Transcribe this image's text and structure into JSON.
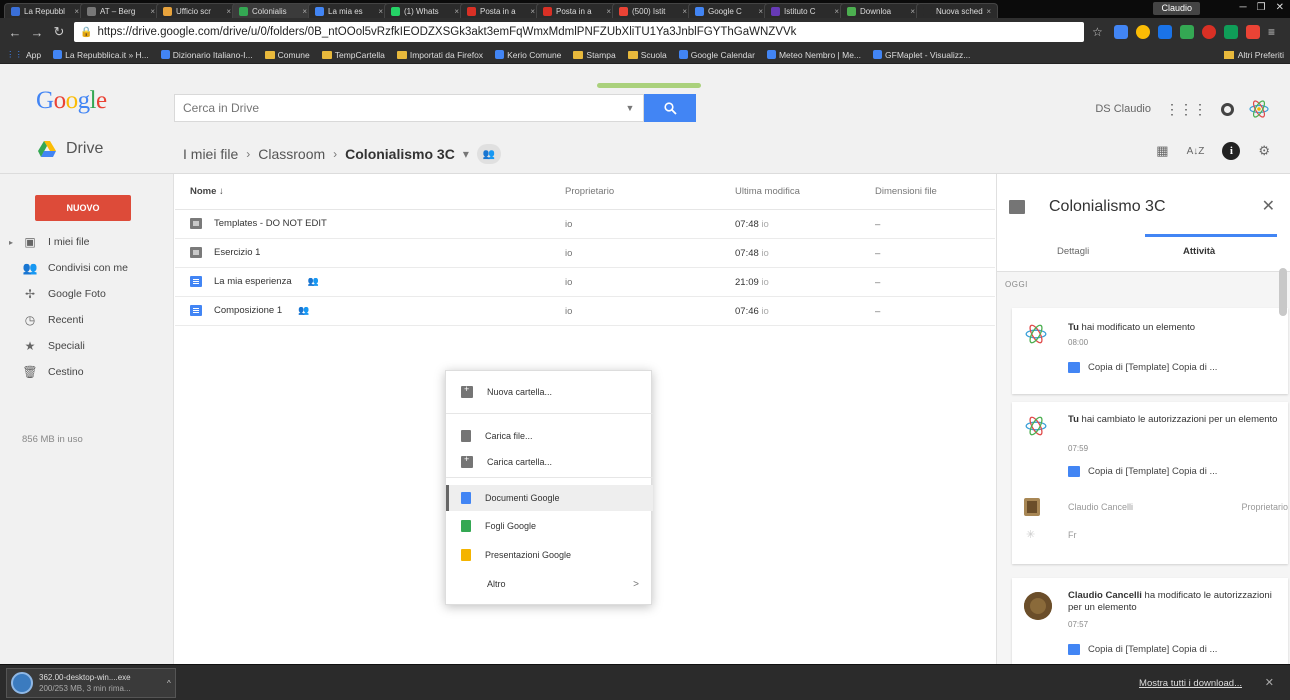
{
  "browser": {
    "tabs": [
      {
        "label": "La Repubbl",
        "color": "#3a6fd8"
      },
      {
        "label": "AT – Berg",
        "color": "#777777"
      },
      {
        "label": "Ufficio scr",
        "color": "#e8a33c"
      },
      {
        "label": "Colonialis",
        "color": "#34a853",
        "active": true
      },
      {
        "label": "La mia es",
        "color": "#4285f4"
      },
      {
        "label": "(1) Whats",
        "color": "#25d366"
      },
      {
        "label": "Posta in a",
        "color": "#d93025"
      },
      {
        "label": "Posta in a",
        "color": "#d93025"
      },
      {
        "label": "(500) Istit",
        "color": "#ea4335"
      },
      {
        "label": "Google C",
        "color": "#4285f4"
      },
      {
        "label": "Istituto C",
        "color": "#673ab7"
      },
      {
        "label": "Downloa",
        "color": "#4caf50"
      },
      {
        "label": "Nuova sched",
        "color": "#2b2b2b"
      }
    ],
    "user": "Claudio",
    "url": "https://drive.google.com/drive/u/0/folders/0B_ntOOol5vRzfkIEODZXSGk3akt3emFqWmxMdmlPNFZUbXliTU1Ya3JnblFGYThGaWNZVVk",
    "bookmarks": [
      {
        "label": "App",
        "kind": "apps"
      },
      {
        "label": "La Repubblica.it » H...",
        "kind": "site"
      },
      {
        "label": "Dizionario Italiano-I...",
        "kind": "site"
      },
      {
        "label": "Comune",
        "kind": "folder"
      },
      {
        "label": "TempCartella",
        "kind": "folder"
      },
      {
        "label": "Importati da Firefox",
        "kind": "folder"
      },
      {
        "label": "Kerio Comune",
        "kind": "site"
      },
      {
        "label": "Stampa",
        "kind": "folder"
      },
      {
        "label": "Scuola",
        "kind": "folder"
      },
      {
        "label": "Google Calendar",
        "kind": "site"
      },
      {
        "label": "Meteo Nembro | Me...",
        "kind": "site"
      },
      {
        "label": "GFMaplet - Visualizz...",
        "kind": "site"
      }
    ],
    "other_bookmarks": "Altri Preferiti"
  },
  "header": {
    "search_placeholder": "Cerca in Drive",
    "account_name": "DS Claudio"
  },
  "toolbar": {
    "app_name": "Drive",
    "breadcrumb": [
      "I miei file",
      "Classroom",
      "Colonialismo 3C"
    ]
  },
  "sidebar": {
    "new_label": "NUOVO",
    "items": [
      {
        "label": "I miei file",
        "icon": "drive-folder-icon"
      },
      {
        "label": "Condivisi con me",
        "icon": "shared-icon"
      },
      {
        "label": "Google Foto",
        "icon": "photos-icon"
      },
      {
        "label": "Recenti",
        "icon": "clock-icon"
      },
      {
        "label": "Speciali",
        "icon": "star-icon"
      },
      {
        "label": "Cestino",
        "icon": "trash-icon"
      }
    ],
    "storage": "856 MB in uso"
  },
  "files": {
    "columns": [
      "Nome",
      "Proprietario",
      "Ultima modifica",
      "Dimensioni file"
    ],
    "rows": [
      {
        "name": "Templates - DO NOT EDIT",
        "type": "folder",
        "owner": "io",
        "modified": "07:48",
        "by": "io",
        "size": "–",
        "shared": false
      },
      {
        "name": "Esercizio 1",
        "type": "folder",
        "owner": "io",
        "modified": "07:48",
        "by": "io",
        "size": "–",
        "shared": false
      },
      {
        "name": "La mia esperienza",
        "type": "doc",
        "owner": "io",
        "modified": "21:09",
        "by": "io",
        "size": "–",
        "shared": true
      },
      {
        "name": "Composizione 1",
        "type": "doc",
        "owner": "io",
        "modified": "07:46",
        "by": "io",
        "size": "–",
        "shared": true
      }
    ]
  },
  "context_menu": {
    "items": [
      {
        "label": "Nuova cartella...",
        "icon": "new-folder-icon"
      },
      {
        "label": "Carica file...",
        "icon": "upload-file-icon"
      },
      {
        "label": "Carica cartella...",
        "icon": "upload-folder-icon"
      },
      {
        "label": "Documenti Google",
        "icon": "docs-icon"
      },
      {
        "label": "Fogli Google",
        "icon": "sheets-icon"
      },
      {
        "label": "Presentazioni Google",
        "icon": "slides-icon"
      },
      {
        "label": "Altro",
        "icon": "",
        "arrow": ">"
      }
    ]
  },
  "details": {
    "title": "Colonialismo 3C",
    "tab_details": "Dettagli",
    "tab_activity": "Attività",
    "section": "OGGI",
    "activities": [
      {
        "actor": "Tu",
        "action": "hai modificato un elemento",
        "time": "08:00",
        "ref": "Copia di [Template] Copia di ..."
      },
      {
        "actor": "Tu",
        "action": "hai cambiato le autorizzazioni per un elemento",
        "time": "07:59",
        "ref": "Copia di [Template] Copia di ...",
        "person": "Claudio Cancelli",
        "role": "Proprietario",
        "extra": "Fr"
      },
      {
        "actor": "Claudio Cancelli",
        "action": "ha modificato le autorizzazioni per un elemento",
        "time": "07:57",
        "ref": "Copia di [Template] Copia di ..."
      }
    ]
  },
  "downloads": {
    "file": "362.00-desktop-win....exe",
    "status": "200/253 MB, 3 min rima...",
    "show_all": "Mostra tutti i download..."
  }
}
